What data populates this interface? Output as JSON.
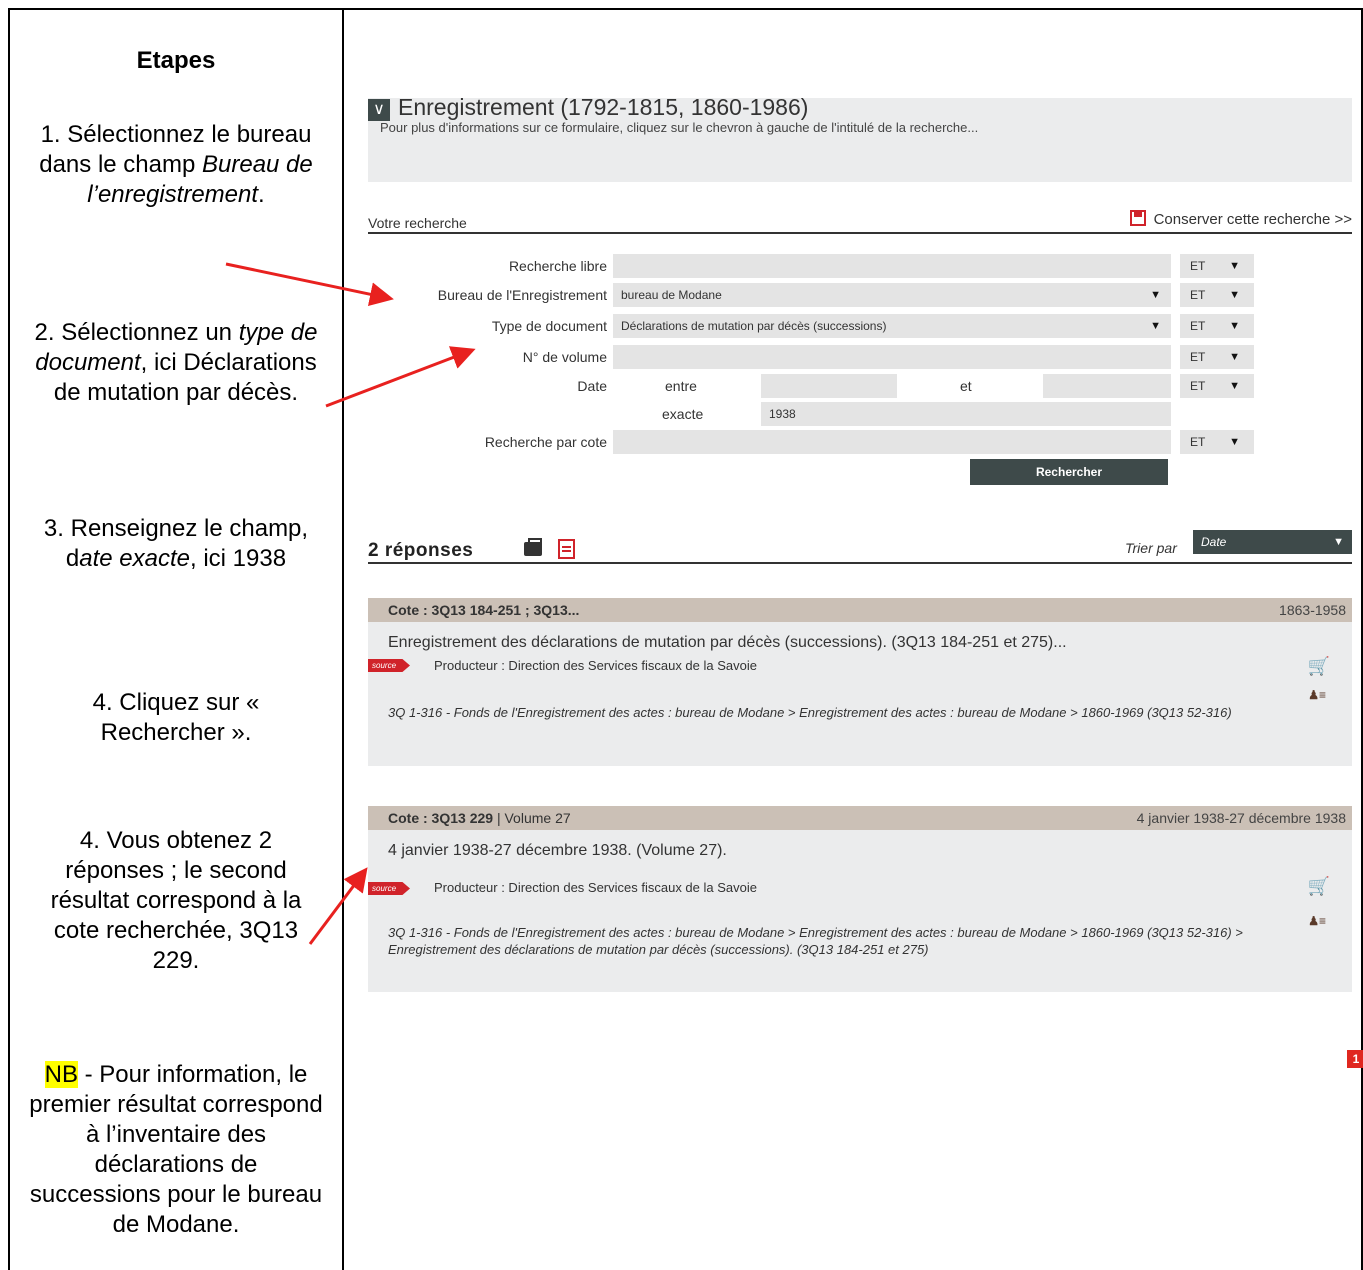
{
  "steps": {
    "heading": "Etapes",
    "s1_a": "1. Sélectionnez le bureau dans le champ",
    "s1_em": "Bureau de l’enregistrement",
    "s1_end": ".",
    "s2_a": "2. Sélectionnez un",
    "s2_em": "type de document",
    "s2_b": ", ici Déclarations de mutation par décès.",
    "s3_a": "3. Renseignez le champ, d",
    "s3_em": "ate exacte",
    "s3_b": ", ici 1938",
    "s4": "4. Cliquez sur « Rechercher ».",
    "s5": "4. Vous obtenez 2 réponses ; le second résultat correspond à la cote recherchée, 3Q13 229.",
    "nb_tag": "NB",
    "nb_text": " - Pour information, le premier résultat correspond à l’inventaire des déclarations de successions pour le bureau de Modane."
  },
  "form": {
    "title": "Enregistrement (1792-1815, 1860-1986)",
    "subtitle": "Pour plus d'informations sur ce formulaire, cliquez sur le chevron à gauche de l'intitulé de la recherche...",
    "search_label": "Votre recherche",
    "save_label": "Conserver cette recherche >>",
    "fields": {
      "libre": "Recherche libre",
      "bureau": "Bureau de l'Enregistrement",
      "bureau_value": "bureau de Modane",
      "type": "Type de document",
      "type_value": "Déclarations de mutation par décès (successions)",
      "volume": "N° de volume",
      "date": "Date",
      "entre": "entre",
      "et": "et",
      "exacte": "exacte",
      "exacte_value": "1938",
      "cote": "Recherche par cote"
    },
    "operator": "ET",
    "search_button": "Rechercher"
  },
  "results": {
    "count": "2  réponses",
    "sort_label": "Trier par",
    "sort_value": "Date",
    "items": [
      {
        "cote": "Cote : 3Q13 184-251 ; 3Q13...",
        "extra": "",
        "dates": "1863-1958",
        "title": "Enregistrement des déclarations de mutation par décès (successions). (3Q13 184-251 et 275)...",
        "source": "source",
        "producer": "Producteur : Direction des Services fiscaux de la Savoie",
        "path": "3Q 1-316 - Fonds de l'Enregistrement des actes : bureau de Modane > Enregistrement des actes : bureau de Modane > 1860-1969 (3Q13 52-316)"
      },
      {
        "cote": "Cote : 3Q13 229",
        "extra": " | Volume 27",
        "dates": "4 janvier 1938-27 décembre 1938",
        "title": "4 janvier 1938-27 décembre 1938. (Volume 27).",
        "source": "source",
        "producer": "Producteur : Direction des Services fiscaux de la Savoie",
        "path": "3Q 1-316 - Fonds de l'Enregistrement des actes : bureau de Modane > Enregistrement des actes : bureau de Modane > 1860-1969 (3Q13 52-316) > Enregistrement des déclarations de mutation par décès (successions). (3Q13 184-251 et 275)"
      }
    ],
    "page": "1"
  },
  "icons": {
    "chevron": "chevron-down-icon",
    "save": "floppy-icon",
    "print": "printer-icon",
    "pdf": "pdf-icon",
    "cart": "cart-icon",
    "person": "person-icon"
  },
  "colors": {
    "accent_dark": "#3e4a4a",
    "red": "#d0232a",
    "card_bar": "#cbc0b6",
    "card_bg": "#ebeced",
    "field_bg": "#e4e4e4",
    "highlight": "#ffff00",
    "arrow": "#e8211f"
  }
}
